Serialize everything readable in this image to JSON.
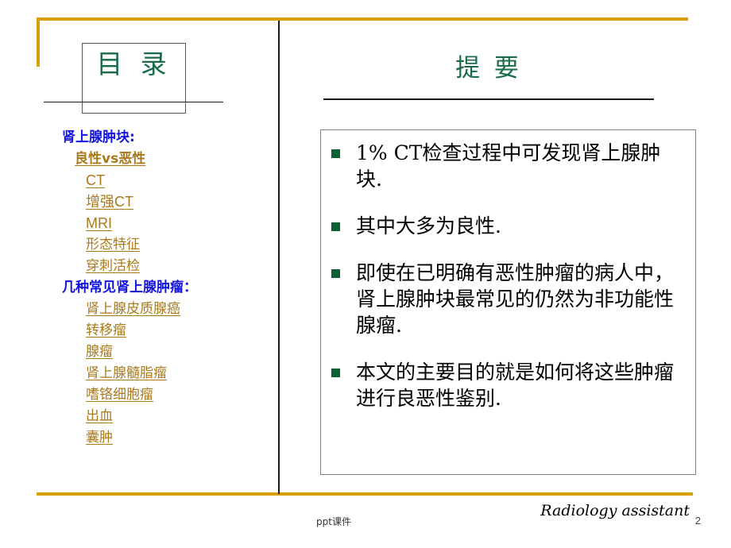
{
  "slide": {
    "page_number": "2",
    "accent_gold": "#d9a006",
    "accent_green": "#1a6b47",
    "bullet_green": "#0b6135",
    "toc_link_color": "#a9791a",
    "toc_head_color": "#1313e0"
  },
  "left": {
    "title": "目  录",
    "groups": [
      {
        "heading": "肾上腺肿块:",
        "items": [
          {
            "label": "良性vs恶性",
            "style": "bold-sans"
          },
          {
            "label": "CT",
            "style": "sans"
          },
          {
            "label": "增强CT",
            "style": "sans"
          },
          {
            "label": "MRI",
            "style": "sans"
          },
          {
            "label": "形态特征",
            "style": "serif"
          },
          {
            "label": "穿刺活检",
            "style": "serif"
          }
        ]
      },
      {
        "heading": "几种常见肾上腺肿瘤：",
        "items": [
          {
            "label": "肾上腺皮质腺癌",
            "style": "serif"
          },
          {
            "label": "转移瘤",
            "style": "serif"
          },
          {
            "label": "腺瘤",
            "style": "serif"
          },
          {
            "label": "肾上腺髓脂瘤",
            "style": "serif"
          },
          {
            "label": "嗜铬细胞瘤",
            "style": "serif"
          },
          {
            "label": "出血",
            "style": "serif"
          },
          {
            "label": "囊肿",
            "style": "serif"
          }
        ]
      }
    ]
  },
  "right": {
    "title": "提    要",
    "bullets": [
      "1% CT检查过程中可发现肾上腺肿块.",
      "其中大多为良性.",
      "即使在已明确有恶性肿瘤的病人中，肾上腺肿块最常见的仍然为非功能性腺瘤.",
      "本文的主要目的就是如何将这些肿瘤进行良恶性鉴别."
    ]
  },
  "footer": {
    "center": "ppt课件",
    "right": "Radiology assistant"
  }
}
